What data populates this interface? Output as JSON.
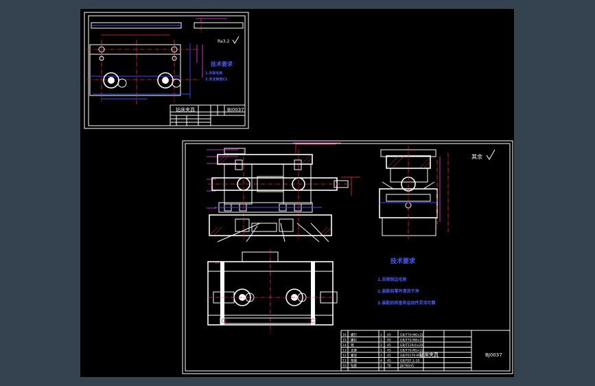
{
  "sheet1": {
    "title": "钻床夹具",
    "drawing_no": "BJ0037",
    "roughness_mark": "Ra3.2",
    "notes_title": "技术要求",
    "notes": [
      "1.去除毛刺",
      "2.未注倒角C1"
    ]
  },
  "sheet2": {
    "title": "钻床夹具",
    "drawing_no": "BJ0037",
    "roughness_other": "其余",
    "notes_title": "技术要求",
    "notes": [
      "1.去除锐边毛刺",
      "2.装配前零件清洗干净",
      "3.装配后检查各运动件灵活可靠"
    ],
    "parts": [
      {
        "no": "16",
        "name": "螺钉",
        "qty": "1",
        "material": "45",
        "std": "GB/T70-M6×20"
      },
      {
        "no": "15",
        "name": "螺钉",
        "qty": "2",
        "material": "45",
        "std": "GB/T70-M8×25"
      },
      {
        "no": "14",
        "name": "销",
        "qty": "2",
        "material": "45",
        "std": "GB/T119-6×20"
      },
      {
        "no": "13",
        "name": "支座",
        "qty": "1",
        "material": "45",
        "std": "GB/T70-M5×12"
      },
      {
        "no": "12",
        "name": "螺母",
        "qty": "2",
        "material": "45",
        "std": "GB/T6170-M10"
      },
      {
        "no": "11",
        "name": "垫圈",
        "qty": "4",
        "material": "45",
        "std": "GB/T97.1-10"
      },
      {
        "no": "10",
        "name": "钻套",
        "qty": "2",
        "material": "T8",
        "std": "JB/T8045"
      }
    ]
  }
}
